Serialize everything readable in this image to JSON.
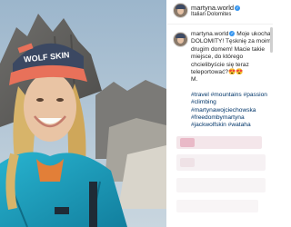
{
  "post": {
    "username": "martyna.world",
    "location": "Italian Dolomites",
    "verified_icon": "verified-badge-icon",
    "caption": {
      "username": "martyna.world",
      "text": "Moje ukochane DOLOMITY! Tęsknię za moim drugim domem! Macie takie miejsce, do którego chcielibyście się teraz teleportować?😍😍",
      "text_tail": "M.",
      "hashtags": "#travel #mountains #passion #climbing #martynawojciechowska #freedombymartyna #jackwolfskin #wataha"
    }
  },
  "photo": {
    "description_icon": "photo",
    "cap_text": "WOLF SKIN"
  },
  "colors": {
    "link": "#003569",
    "verified": "#3897f0",
    "text": "#262626"
  }
}
